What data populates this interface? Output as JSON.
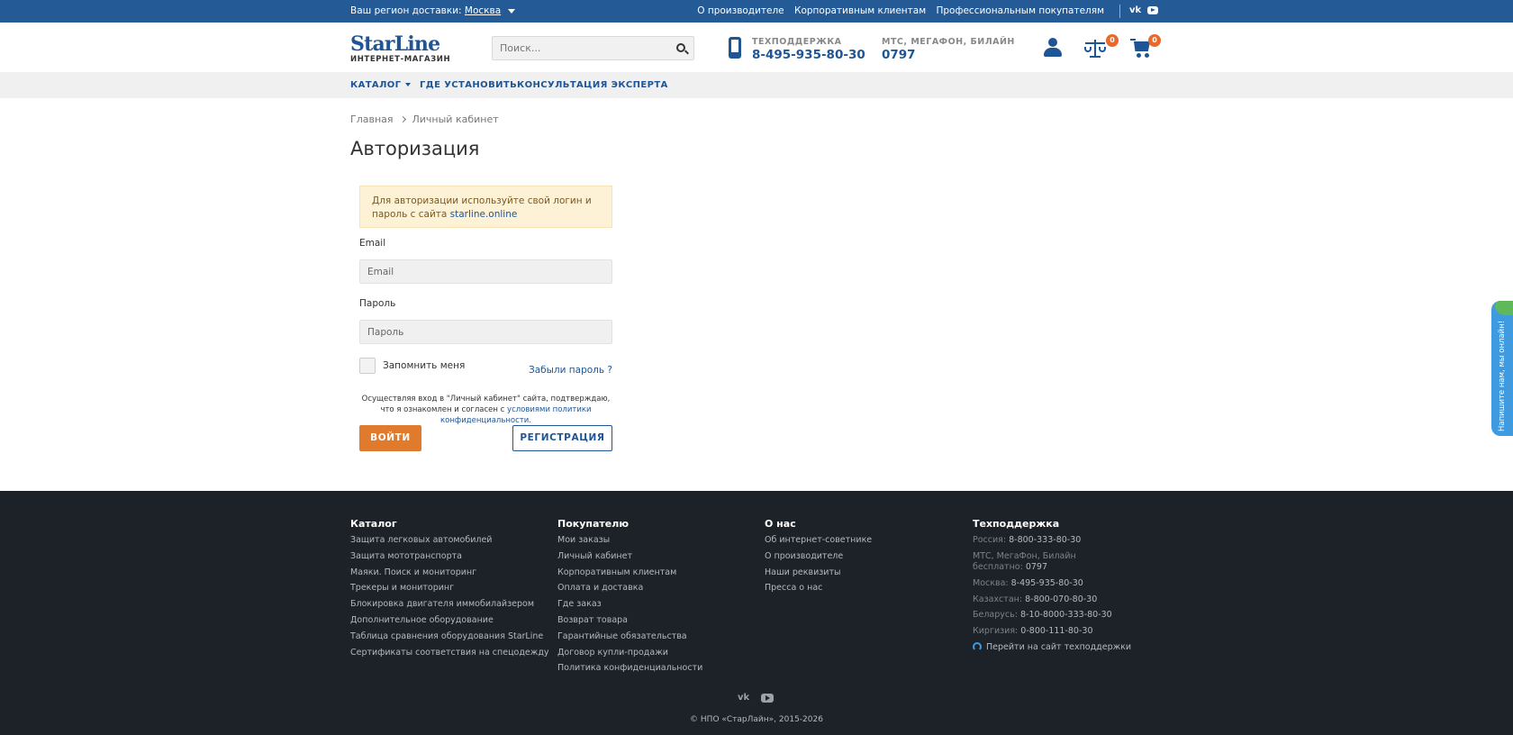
{
  "topbar": {
    "region_label": "Ваш регион доставки:",
    "region_city": "Москва",
    "links": [
      "О производителе",
      "Корпоративным клиентам",
      "Профессиональным покупателям"
    ],
    "vk": "vk"
  },
  "header": {
    "logo_brand": "StarLine",
    "logo_sub": "ИНТЕРНЕТ-МАГАЗИН",
    "search_placeholder": "Поиск...",
    "support_label": "ТЕХПОДДЕРЖКА",
    "support_phone": "8-495-935-80-30",
    "mobile_label": "МТС, МЕГАФОН, БИЛАЙН",
    "mobile_phone": "0797",
    "compare_count": "0",
    "cart_count": "0"
  },
  "nav": {
    "catalog": "КАТАЛОГ",
    "where": "ГДЕ УСТАНОВИТЬ",
    "consult": "КОНСУЛЬТАЦИЯ ЭКСПЕРТА"
  },
  "breadcrumbs": [
    "Главная",
    "Личный кабинет"
  ],
  "page_title": "Авторизация",
  "login": {
    "notice_text": "Для авторизации используйте свой логин и пароль с сайта ",
    "notice_link": "starline.online",
    "email_label": "Email",
    "email_placeholder": "Email",
    "password_label": "Пароль",
    "password_placeholder": "Пароль",
    "remember": "Запомнить меня",
    "forgot": "Забыли пароль ?",
    "agree_text": "Осуществляя вход в \"Личный кабинет\" сайта, подтверждаю, что я ознакомлен и согласен с ",
    "agree_link": "условиями политики конфиденциальности",
    "login_button": "ВОЙТИ",
    "register_button": "РЕГИСТРАЦИЯ"
  },
  "chat_tab": "Напишите нам, мы онлайн!",
  "footer": {
    "catalog": {
      "title": "Каталог",
      "items": [
        "Защита легковых автомобилей",
        "Защита мототранспорта",
        "Маяки. Поиск и мониторинг",
        "Трекеры и мониторинг",
        "Блокировка двигателя иммобилайзером",
        "Дополнительное оборудование",
        "Таблица сравнения оборудования StarLine",
        "Сертификаты соответствия на спецодежду"
      ]
    },
    "buyer": {
      "title": "Покупателю",
      "items": [
        "Мои заказы",
        "Личный кабинет",
        "Корпоративным клиентам",
        "Оплата и доставка",
        "Где заказ",
        "Возврат товара",
        "Гарантийные обязательства",
        "Договор купли-продажи",
        "Политика конфиденциальности"
      ]
    },
    "about": {
      "title": "О нас",
      "items": [
        "Об интернет-советнике",
        "О производителе",
        "Наши реквизиты",
        "Пресса о нас"
      ]
    },
    "support": {
      "title": "Техподдержка",
      "russia_label": "Россия:",
      "russia_phone": "8-800-333-80-30",
      "mts_label": "МТС, МегаФон, Билайн",
      "mts_free": "бесплатно:",
      "mts_phone": "0797",
      "moscow_label": "Москва:",
      "moscow_phone": "8-495-935-80-30",
      "kz_label": "Казахстан:",
      "kz_phone": "8-800-070-80-30",
      "by_label": "Беларусь:",
      "by_phone": "8-10-8000-333-80-30",
      "kg_label": "Киргизия:",
      "kg_phone": "0-800-111-80-30",
      "site_link": "Перейти на сайт техподдержки"
    },
    "vk": "vk",
    "copyright": "© НПО «СтарЛайн», 2015-2026"
  },
  "colors": {
    "brand_blue": "#1f5594",
    "topbar_blue": "#245a96",
    "accent_orange": "#e07a2d",
    "footer_bg": "#1d2128"
  }
}
